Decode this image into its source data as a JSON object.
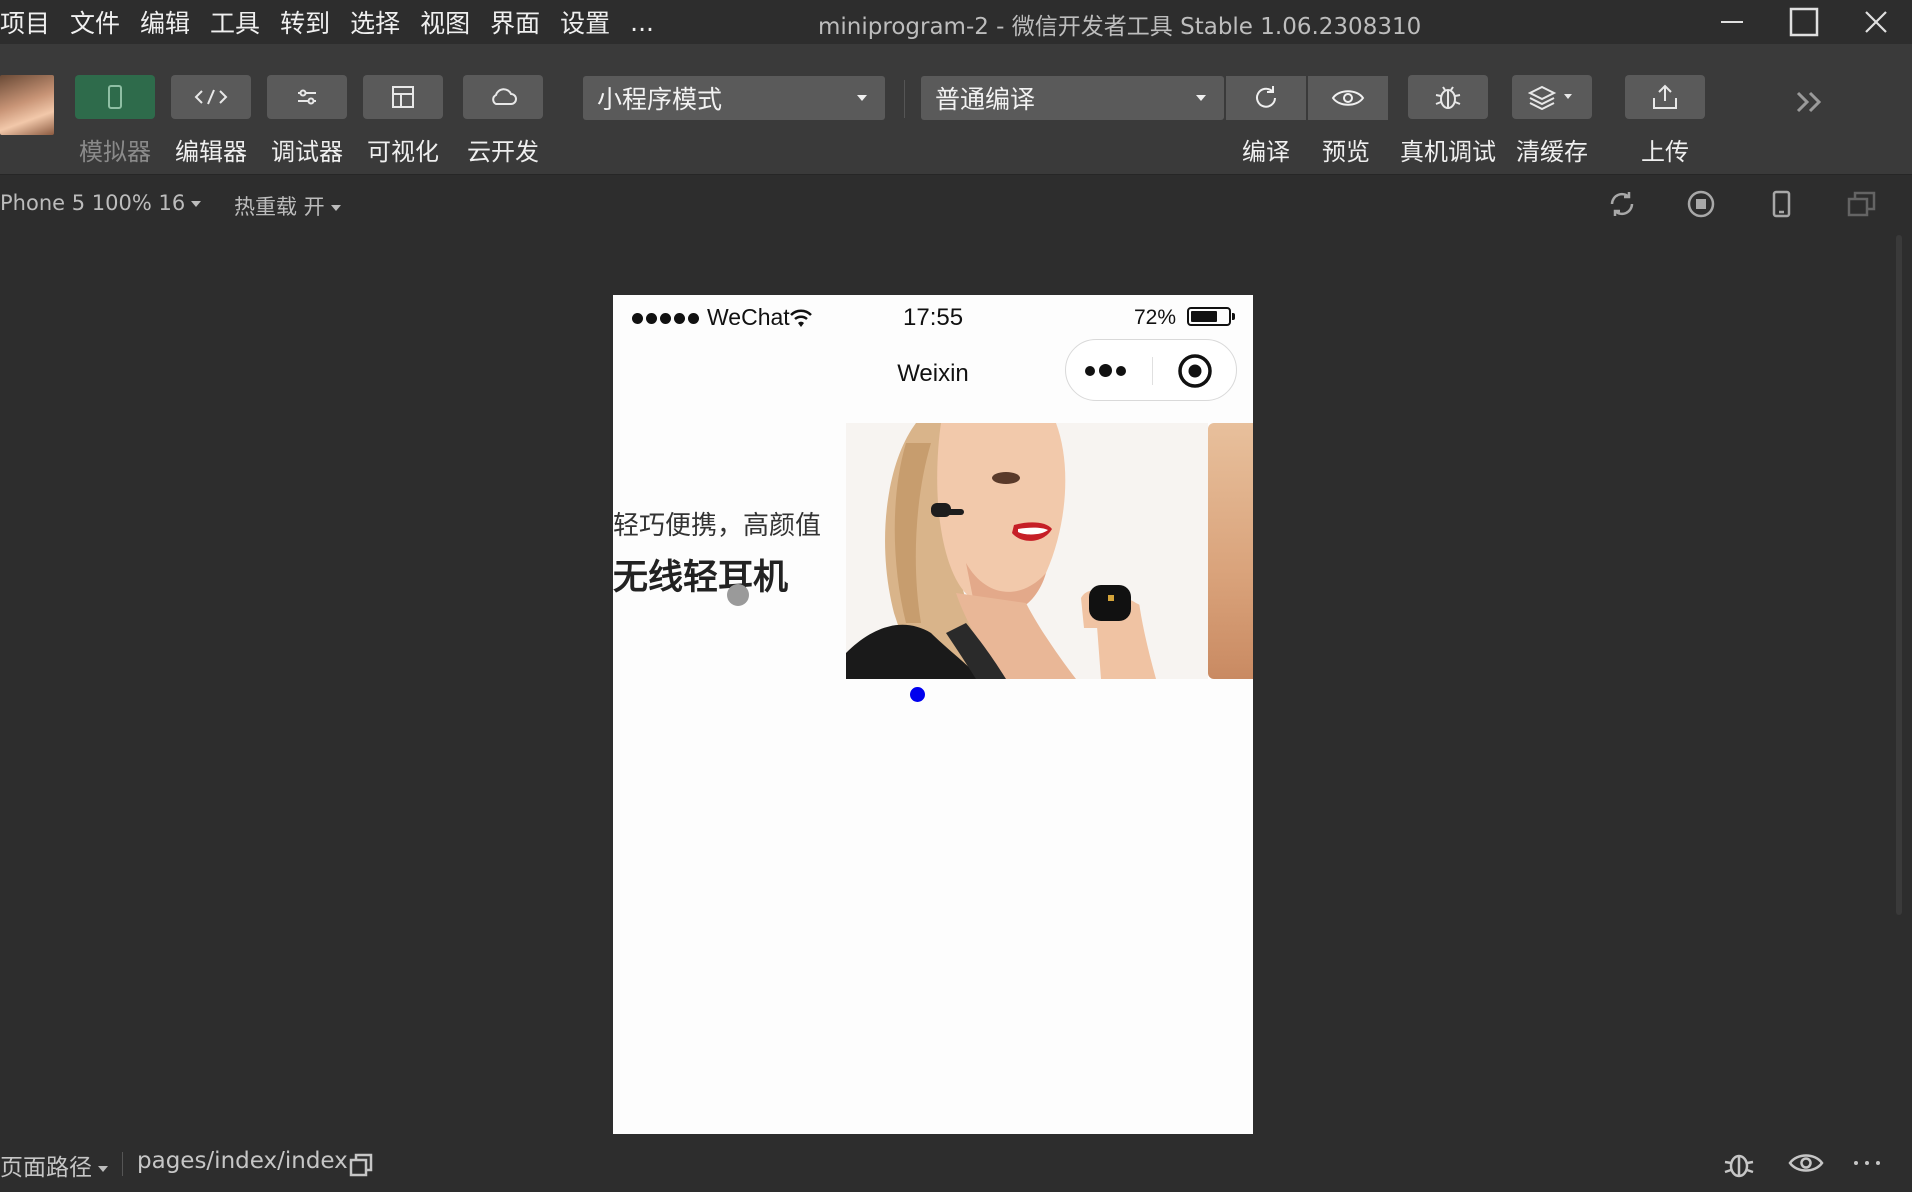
{
  "menu": [
    "项目",
    "文件",
    "编辑",
    "工具",
    "转到",
    "选择",
    "视图",
    "界面",
    "设置",
    "..."
  ],
  "window": {
    "title": "miniprogram-2 - 微信开发者工具 Stable 1.06.2308310"
  },
  "toolbar": {
    "simulator": "模拟器",
    "editor": "编辑器",
    "debugger": "调试器",
    "visual": "可视化",
    "cloud": "云开发",
    "mode_select": "小程序模式",
    "compile_select": "普通编译",
    "compile": "编译",
    "preview": "预览",
    "real_debug": "真机调试",
    "clear_cache": "清缓存",
    "upload": "上传"
  },
  "subbar": {
    "device": "Phone 5 100% 16",
    "hot_reload": "热重载 开"
  },
  "phone": {
    "carrier": "WeChat",
    "time": "17:55",
    "battery": "72%",
    "battery_level": 0.72,
    "nav_title": "Weixin",
    "slide": {
      "subtitle": "轻巧便携，高颜值",
      "title": "无线轻耳机"
    }
  },
  "bottombar": {
    "page_path_label": "页面路径",
    "page_path": "pages/index/index"
  },
  "colors": {
    "active_indicator": "#0000ee",
    "simulator_active": "#2e6b4b"
  }
}
